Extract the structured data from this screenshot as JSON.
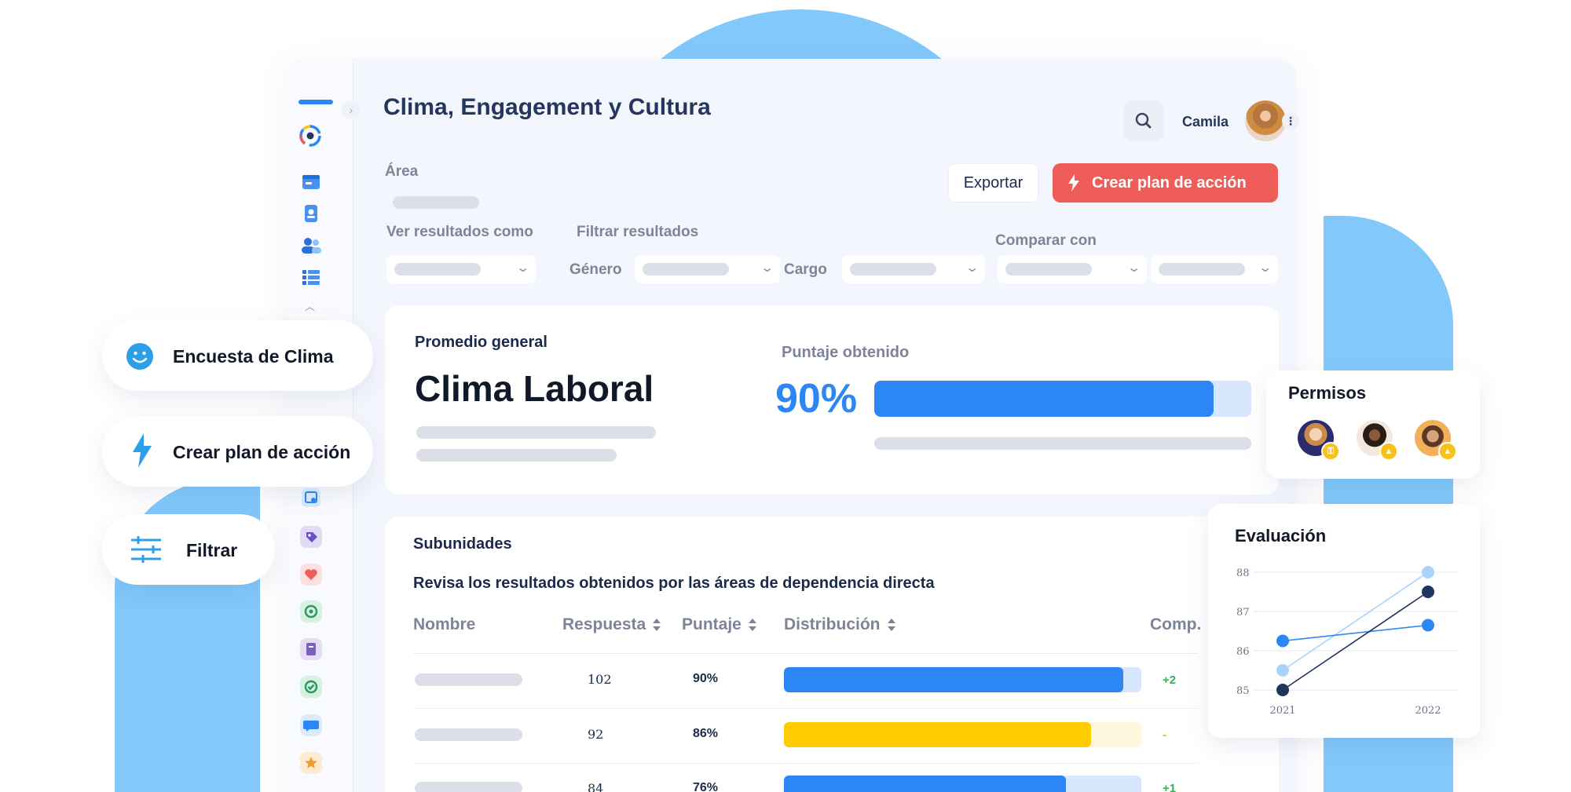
{
  "app": {
    "title": "Clima, Engagement y Cultura",
    "user_name": "Camila"
  },
  "filters": {
    "area_label": "Área",
    "ver_resultados_label": "Ver resultados como",
    "filtrar_resultados_label": "Filtrar resultados",
    "genero_label": "Género",
    "cargo_label": "Cargo",
    "comparar_label": "Comparar con"
  },
  "actions": {
    "export_label": "Exportar",
    "plan_label": "Crear plan de acción"
  },
  "promedio": {
    "label": "Promedio general",
    "title": "Clima Laboral",
    "score_label": "Puntaje obtenido",
    "score_text": "90%",
    "score_fraction": 0.9
  },
  "subunidades": {
    "title": "Subunidades",
    "description": "Revisa los resultados obtenidos por las áreas de dependencia directa",
    "columns": {
      "nombre": "Nombre",
      "respuesta": "Respuesta",
      "puntaje": "Puntaje",
      "distribucion": "Distribución",
      "comp": "Comp."
    },
    "rows": [
      {
        "respuesta": "102",
        "puntaje": "90%",
        "fraction": 0.95,
        "color": "#2d86f5",
        "track": "#d7e7fd",
        "comp": "+2",
        "comp_color": "#3cae5e"
      },
      {
        "respuesta": "92",
        "puntaje": "86%",
        "fraction": 0.86,
        "color": "#ffcc00",
        "track": "#fff7dd",
        "comp": "-",
        "comp_color": "#f0b400"
      },
      {
        "respuesta": "84",
        "puntaje": "76%",
        "fraction": 0.79,
        "color": "#2d86f5",
        "track": "#d7e7fd",
        "comp": "+1",
        "comp_color": "#3cae5e"
      }
    ]
  },
  "floating": {
    "encuesta": {
      "label": "Encuesta de Clima",
      "icon": "smiley-icon"
    },
    "plan": {
      "label": "Crear plan de acción",
      "icon": "lightning-icon"
    },
    "filtrar": {
      "label": "Filtrar",
      "icon": "sliders-icon"
    }
  },
  "permisos": {
    "title": "Permisos"
  },
  "evaluacion": {
    "title": "Evaluación"
  },
  "chart_data": {
    "type": "line",
    "title": "Evaluación",
    "x": [
      "2021",
      "2022"
    ],
    "ylim": [
      85,
      88
    ],
    "yticks": [
      "85",
      "86",
      "87",
      "88"
    ],
    "series": [
      {
        "values": [
          85.5,
          88.0
        ],
        "color": "#a9d3fb"
      },
      {
        "values": [
          86.25,
          86.65
        ],
        "color": "#2d86f5"
      },
      {
        "values": [
          85.0,
          87.5
        ],
        "color": "#1f3560"
      }
    ]
  },
  "colors": {
    "primary": "#2d86f5",
    "danger": "#ee5d58",
    "navy": "#24365d"
  }
}
